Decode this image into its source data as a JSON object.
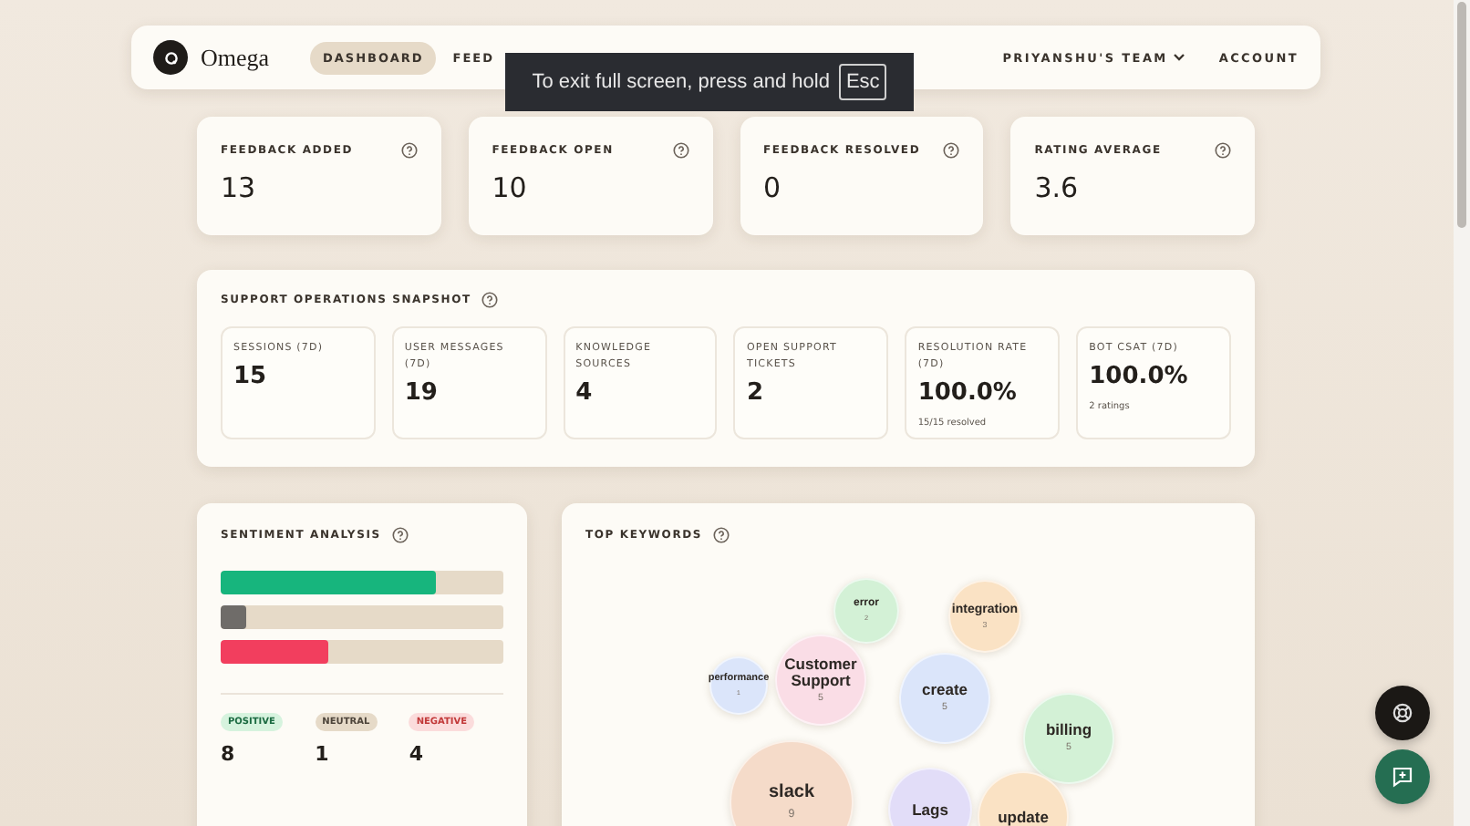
{
  "nav": {
    "logo": "Omega",
    "items": [
      {
        "label": "DASHBOARD",
        "selected": true
      },
      {
        "label": "FEED",
        "selected": false
      }
    ],
    "team": "PRIYANSHU'S TEAM",
    "account": "ACCOUNT"
  },
  "fullscreen_toast": {
    "text": "To exit full screen, press and hold",
    "key": "Esc"
  },
  "stats": [
    {
      "label": "FEEDBACK ADDED",
      "value": "13"
    },
    {
      "label": "FEEDBACK OPEN",
      "value": "10"
    },
    {
      "label": "FEEDBACK RESOLVED",
      "value": "0"
    },
    {
      "label": "RATING AVERAGE",
      "value": "3.6"
    }
  ],
  "snapshot": {
    "title": "SUPPORT OPERATIONS SNAPSHOT",
    "metrics": [
      {
        "label": "SESSIONS (7D)",
        "value": "15"
      },
      {
        "label": "USER MESSAGES (7D)",
        "value": "19"
      },
      {
        "label": "KNOWLEDGE SOURCES",
        "value": "4"
      },
      {
        "label": "OPEN SUPPORT TICKETS",
        "value": "2"
      },
      {
        "label": "RESOLUTION RATE (7D)",
        "value": "100.0%",
        "note": "15/15 resolved"
      },
      {
        "label": "BOT CSAT (7D)",
        "value": "100.0%",
        "note": "2 ratings"
      }
    ]
  },
  "sentiment": {
    "title": "SENTIMENT ANALYSIS",
    "bars": [
      {
        "kind": "positive",
        "level": 0.76
      },
      {
        "kind": "neutral",
        "level": 0.09
      },
      {
        "kind": "negative",
        "level": 0.38
      }
    ],
    "legend": [
      {
        "kind": "positive",
        "label": "POSITIVE",
        "count": "8"
      },
      {
        "kind": "neutral",
        "label": "NEUTRAL",
        "count": "1"
      },
      {
        "kind": "negative",
        "label": "NEGATIVE",
        "count": "4"
      }
    ]
  },
  "keywords": {
    "title": "TOP KEYWORDS",
    "bubbles": [
      {
        "word": "error",
        "count": "2",
        "color": "#d3f1d6"
      },
      {
        "word": "integration",
        "count": "3",
        "color": "#fae2c4"
      },
      {
        "word": "performance",
        "count": "1",
        "color": "#dbe5fa"
      },
      {
        "word": "Customer Support",
        "count": "5",
        "color": "#fadde6"
      },
      {
        "word": "create",
        "count": "5",
        "color": "#dbe5fa"
      },
      {
        "word": "billing",
        "count": "5",
        "color": "#d3f1d6"
      },
      {
        "word": "slack",
        "count": "9",
        "color": "#f5dbc9"
      },
      {
        "word": "Lags",
        "color": "#e2ddf8"
      },
      {
        "word": "update",
        "color": "#fae2c4"
      }
    ]
  }
}
